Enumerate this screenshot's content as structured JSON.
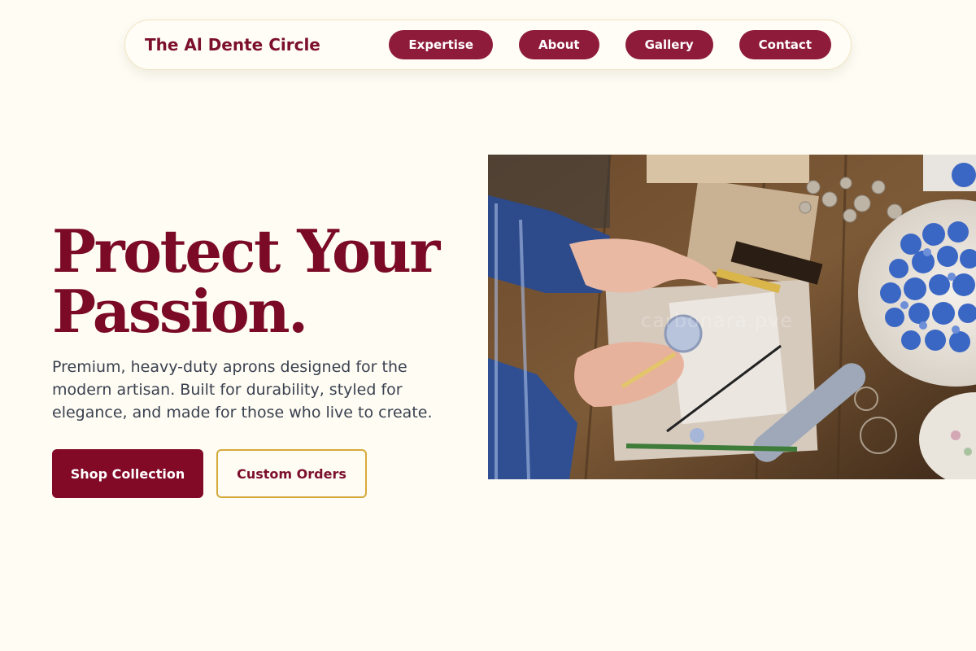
{
  "nav": {
    "brand": "The Al Dente Circle",
    "links": [
      {
        "label": "Expertise"
      },
      {
        "label": "About"
      },
      {
        "label": "Gallery"
      },
      {
        "label": "Contact"
      }
    ]
  },
  "hero": {
    "title_lines": [
      "Protect Your",
      "Passion."
    ],
    "description_lines": [
      "Premium, heavy-duty aprons designed for the",
      "modern artisan. Built for durability, styled for",
      "elegance, and made for those who live to create."
    ],
    "primary_button": "Shop Collection",
    "secondary_button": "Custom Orders"
  },
  "image": {
    "watermark": "carbonara.pve",
    "subject": "artisan-hands-wax-seals"
  },
  "colors": {
    "background": "#fefcf3",
    "brand": "#7c0f2b",
    "nav_pill": "#8e1b3a",
    "primary_button": "#820a27",
    "secondary_border": "#d6a93b",
    "body_text": "#3a4150"
  }
}
